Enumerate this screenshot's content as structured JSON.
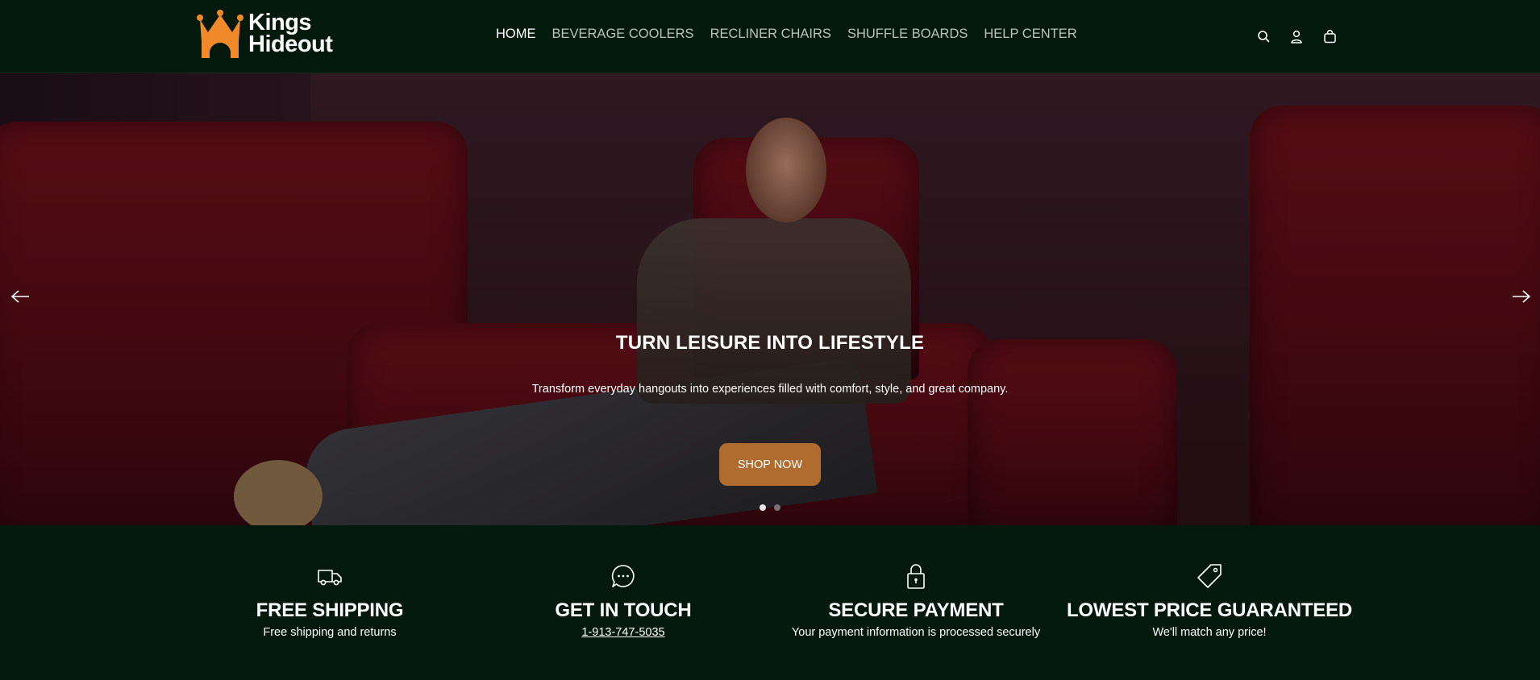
{
  "brand": {
    "name_line1": "Kings",
    "name_line2": "Hideout",
    "logo_color": "#f0892a"
  },
  "nav": {
    "items": [
      {
        "label": "HOME",
        "active": true
      },
      {
        "label": "BEVERAGE COOLERS",
        "active": false
      },
      {
        "label": "RECLINER CHAIRS",
        "active": false
      },
      {
        "label": "SHUFFLE BOARDS",
        "active": false
      },
      {
        "label": "HELP CENTER",
        "active": false
      }
    ]
  },
  "header_icons": [
    "search-icon",
    "account-icon",
    "cart-icon"
  ],
  "hero": {
    "title": "TURN LEISURE INTO LIFESTYLE",
    "subtitle": "Transform everyday hangouts into experiences filled with comfort, style, and great company.",
    "button_label": "SHOP NOW",
    "button_color": "#b06b2e",
    "slides_count": 2,
    "active_slide": 1
  },
  "features": [
    {
      "icon": "truck-icon",
      "title": "FREE SHIPPING",
      "desc": "Free shipping and returns"
    },
    {
      "icon": "chat-icon",
      "title": "GET IN TOUCH",
      "desc": "1-913-747-5035"
    },
    {
      "icon": "lock-icon",
      "title": "SECURE PAYMENT",
      "desc": "Your payment information is processed securely"
    },
    {
      "icon": "price-tag-icon",
      "title": "LOWEST PRICE GUARANTEED",
      "desc": "We'll match any price!"
    }
  ],
  "colors": {
    "header_bg": "#03190c",
    "footer_bg": "#04190d",
    "accent": "#b06b2e"
  }
}
